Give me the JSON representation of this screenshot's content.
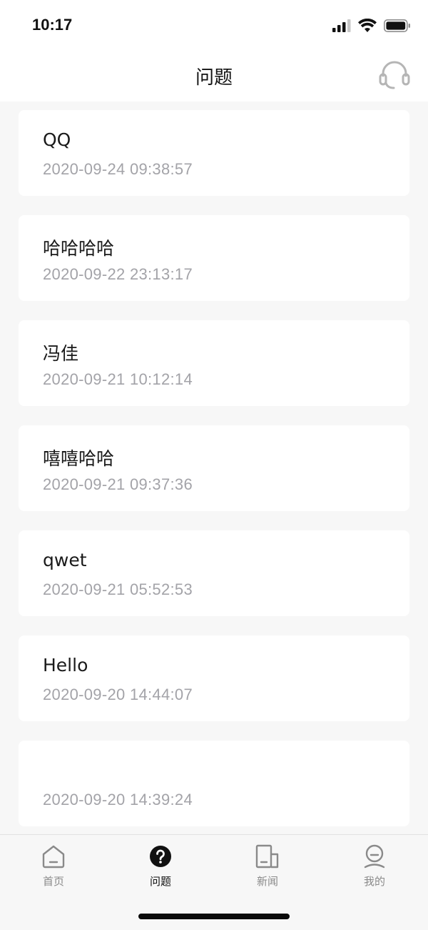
{
  "status_bar": {
    "time": "10:17"
  },
  "nav": {
    "title": "问题",
    "action_icon": "headset-icon"
  },
  "questions": [
    {
      "title": "QQ",
      "time": "2020-09-24 09:38:57"
    },
    {
      "title": "哈哈哈哈",
      "time": "2020-09-22 23:13:17"
    },
    {
      "title": "冯佳",
      "time": "2020-09-21 10:12:14"
    },
    {
      "title": "嘻嘻哈哈",
      "time": "2020-09-21 09:37:36"
    },
    {
      "title": "qwet",
      "time": "2020-09-21 05:52:53"
    },
    {
      "title": "Hello",
      "time": "2020-09-20 14:44:07"
    },
    {
      "title": "",
      "time": "2020-09-20 14:39:24"
    }
  ],
  "tabs": [
    {
      "label": "首页",
      "icon": "home-icon",
      "active": false
    },
    {
      "label": "问题",
      "icon": "question-icon",
      "active": true
    },
    {
      "label": "新闻",
      "icon": "news-icon",
      "active": false
    },
    {
      "label": "我的",
      "icon": "profile-icon",
      "active": false
    }
  ],
  "colors": {
    "background": "#f7f7f7",
    "card": "#ffffff",
    "text_primary": "#1a1a1a",
    "text_secondary": "#a3a3a8",
    "tab_inactive": "#8a8a8a",
    "tab_active": "#111111"
  }
}
